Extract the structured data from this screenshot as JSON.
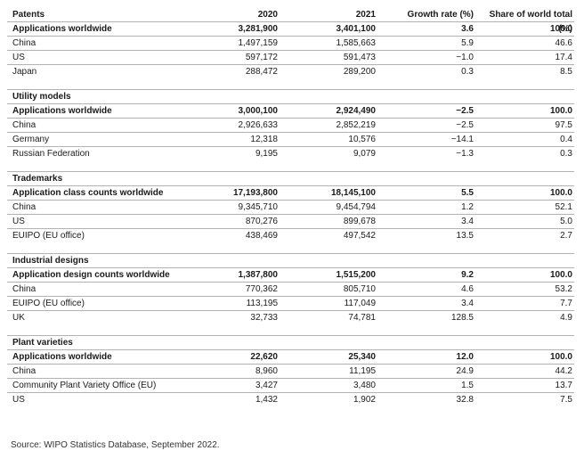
{
  "header": {
    "col0": "Patents",
    "col1": "2020",
    "col2": "2021",
    "col3": "Growth rate (%)",
    "col4": "Share of world total (%)"
  },
  "sections": [
    {
      "title": "Patents",
      "rows": [
        [
          "Applications worldwide",
          "3,281,900",
          "3,401,100",
          "3.6",
          "100.0"
        ],
        [
          "China",
          "1,497,159",
          "1,585,663",
          "5.9",
          "46.6"
        ],
        [
          "US",
          "597,172",
          "591,473",
          "−1.0",
          "17.4"
        ],
        [
          "Japan",
          "288,472",
          "289,200",
          "0.3",
          "8.5"
        ]
      ]
    },
    {
      "title": "Utility models",
      "rows": [
        [
          "Applications worldwide",
          "3,000,100",
          "2,924,490",
          "−2.5",
          "100.0"
        ],
        [
          "China",
          "2,926,633",
          "2,852,219",
          "−2.5",
          "97.5"
        ],
        [
          "Germany",
          "12,318",
          "10,576",
          "−14.1",
          "0.4"
        ],
        [
          "Russian Federation",
          "9,195",
          "9,079",
          "−1.3",
          "0.3"
        ]
      ]
    },
    {
      "title": "Trademarks",
      "rows": [
        [
          "Application class counts worldwide",
          "17,193,800",
          "18,145,100",
          "5.5",
          "100.0"
        ],
        [
          "China",
          "9,345,710",
          "9,454,794",
          "1.2",
          "52.1"
        ],
        [
          "US",
          "870,276",
          "899,678",
          "3.4",
          "5.0"
        ],
        [
          "EUIPO (EU office)",
          "438,469",
          "497,542",
          "13.5",
          "2.7"
        ]
      ]
    },
    {
      "title": "Industrial designs",
      "rows": [
        [
          "Application design counts worldwide",
          "1,387,800",
          "1,515,200",
          "9.2",
          "100.0"
        ],
        [
          "China",
          "770,362",
          "805,710",
          "4.6",
          "53.2"
        ],
        [
          "EUIPO (EU office)",
          "113,195",
          "117,049",
          "3.4",
          "7.7"
        ],
        [
          "UK",
          "32,733",
          "74,781",
          "128.5",
          "4.9"
        ]
      ]
    },
    {
      "title": "Plant varieties",
      "rows": [
        [
          "Applications worldwide",
          "22,620",
          "25,340",
          "12.0",
          "100.0"
        ],
        [
          "China",
          "8,960",
          "11,195",
          "24.9",
          "44.2"
        ],
        [
          "Community Plant Variety Office (EU)",
          "3,427",
          "3,480",
          "1.5",
          "13.7"
        ],
        [
          "US",
          "1,432",
          "1,902",
          "32.8",
          "7.5"
        ]
      ]
    }
  ],
  "source": "Source: WIPO Statistics Database, September 2022."
}
